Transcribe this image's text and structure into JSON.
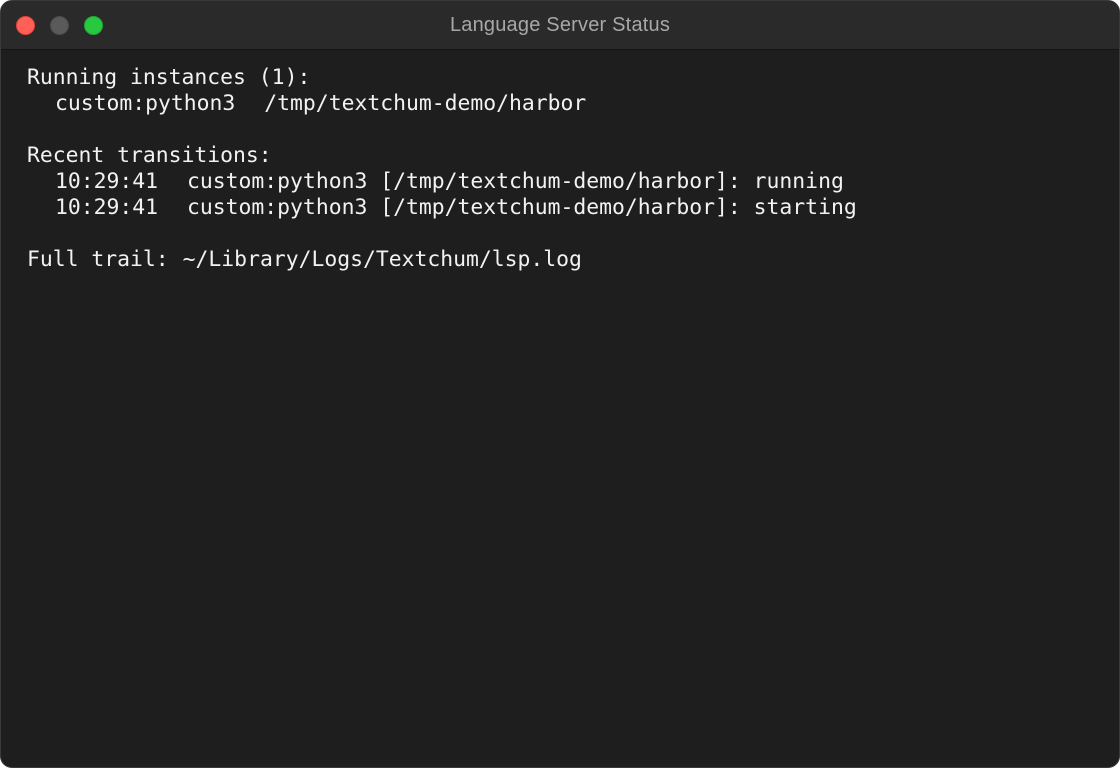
{
  "window": {
    "title": "Language Server Status"
  },
  "running": {
    "heading": "Running instances (1):",
    "instances": [
      {
        "language": "custom:python3",
        "path": "/tmp/textchum-demo/harbor"
      }
    ]
  },
  "recent": {
    "heading": "Recent transitions:",
    "transitions": [
      {
        "time": "10:29:41",
        "message": "custom:python3 [/tmp/textchum-demo/harbor]: running"
      },
      {
        "time": "10:29:41",
        "message": "custom:python3 [/tmp/textchum-demo/harbor]: starting"
      }
    ]
  },
  "trail": {
    "label": "Full trail:",
    "path": "~/Library/Logs/Textchum/lsp.log"
  },
  "colors": {
    "background": "#1e1e1e",
    "titlebar": "#2a2a2a",
    "text": "#f2f2f2",
    "close": "#ff5f57",
    "minimize": "#5a5a5a",
    "zoom": "#28c840"
  }
}
